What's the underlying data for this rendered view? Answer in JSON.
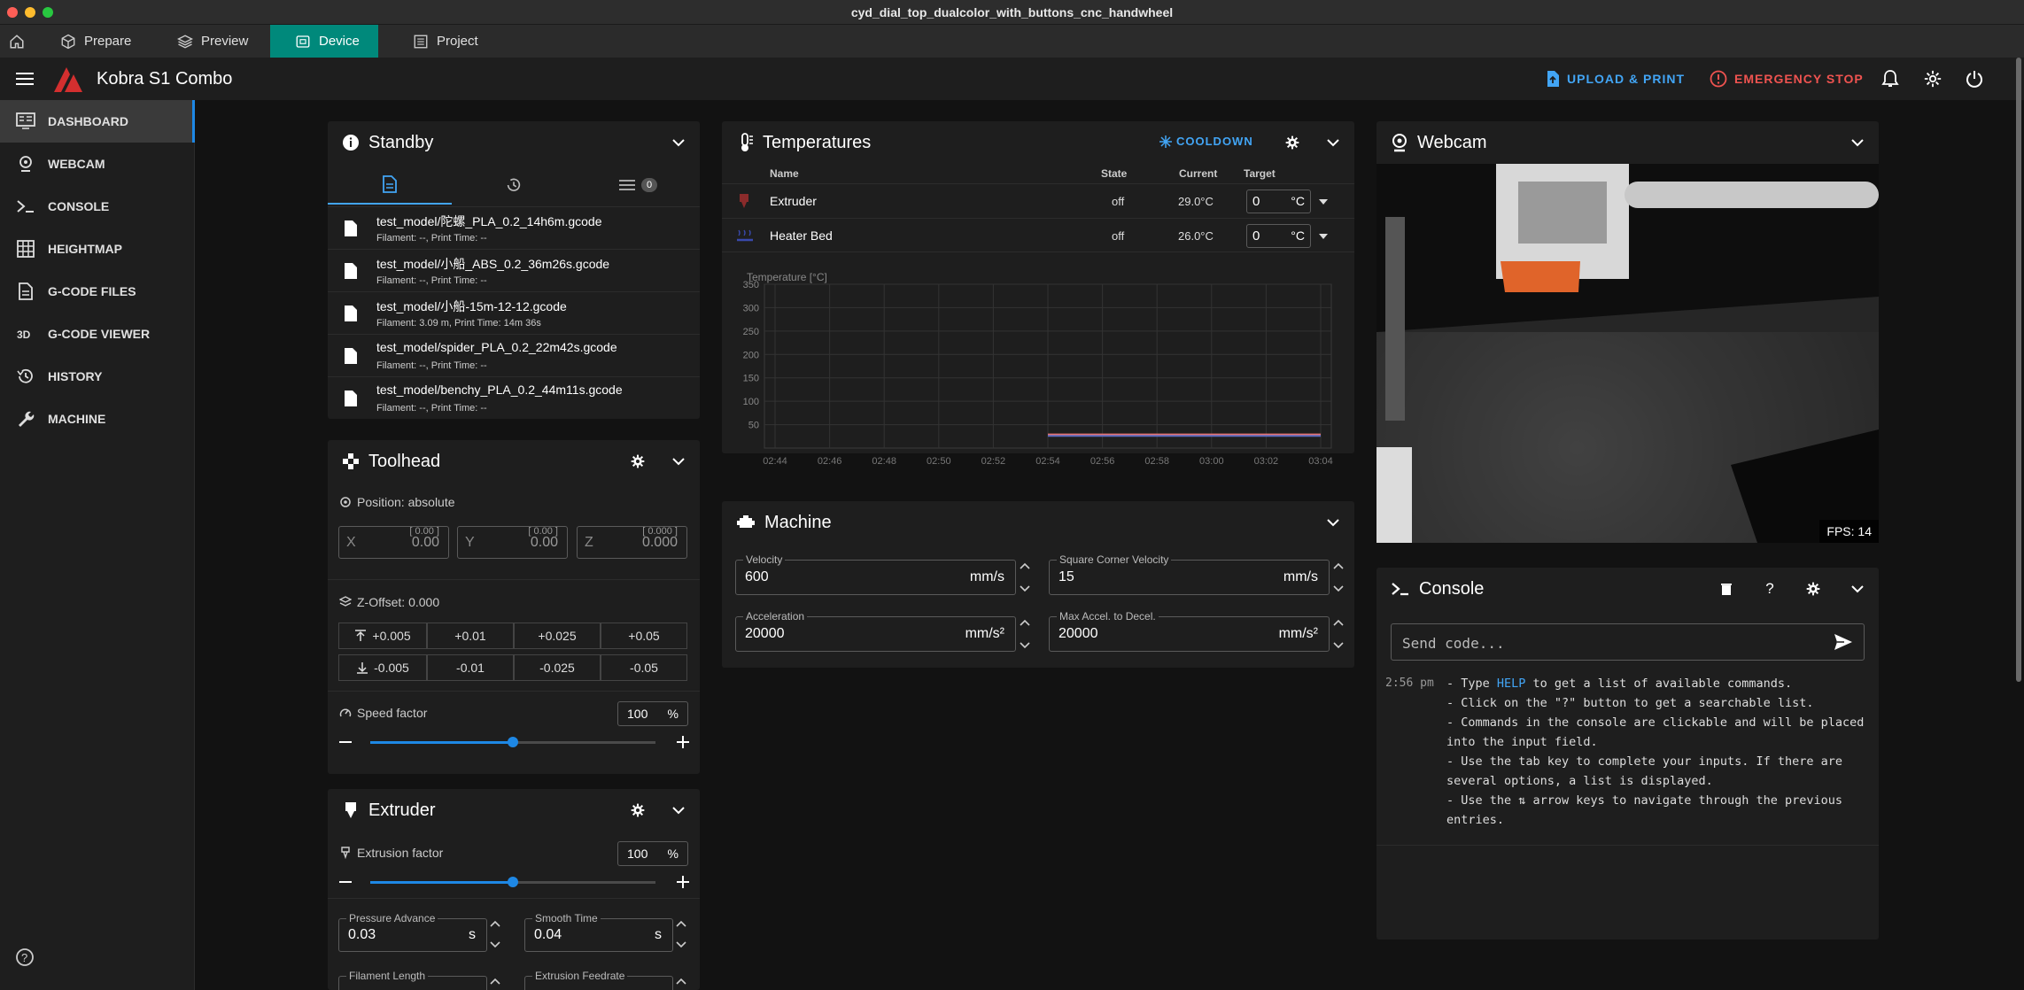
{
  "window": {
    "title": "cyd_dial_top_dualcolor_with_buttons_cnc_handwheel"
  },
  "tabs": [
    {
      "label": "Prepare"
    },
    {
      "label": "Preview"
    },
    {
      "label": "Device"
    },
    {
      "label": "Project"
    }
  ],
  "appbar": {
    "title": "Kobra S1 Combo",
    "upload_label": "UPLOAD & PRINT",
    "estop_label": "EMERGENCY STOP"
  },
  "sidebar": {
    "items": [
      {
        "label": "DASHBOARD",
        "icon": "dashboard-icon"
      },
      {
        "label": "WEBCAM",
        "icon": "webcam-icon"
      },
      {
        "label": "CONSOLE",
        "icon": "console-icon"
      },
      {
        "label": "HEIGHTMAP",
        "icon": "grid-icon"
      },
      {
        "label": "G-CODE FILES",
        "icon": "file-icon"
      },
      {
        "label": "G-CODE VIEWER",
        "icon": "3d-icon"
      },
      {
        "label": "HISTORY",
        "icon": "history-icon"
      },
      {
        "label": "MACHINE",
        "icon": "wrench-icon"
      }
    ]
  },
  "standby": {
    "title": "Standby",
    "queue_count": "0",
    "files": [
      {
        "name": "test_model/陀螺_PLA_0.2_14h6m.gcode",
        "meta": "Filament: --, Print Time: --"
      },
      {
        "name": "test_model/小船_ABS_0.2_36m26s.gcode",
        "meta": "Filament: --, Print Time: --"
      },
      {
        "name": "test_model/小船-15m-12-12.gcode",
        "meta": "Filament: 3.09 m, Print Time: 14m 36s"
      },
      {
        "name": "test_model/spider_PLA_0.2_22m42s.gcode",
        "meta": "Filament: --, Print Time: --"
      },
      {
        "name": "test_model/benchy_PLA_0.2_44m11s.gcode",
        "meta": "Filament: --, Print Time: --"
      }
    ]
  },
  "toolhead": {
    "title": "Toolhead",
    "position_label": "Position: absolute",
    "axes": [
      {
        "label": "X",
        "value": "0.00",
        "hint": "[ 0.00 ]"
      },
      {
        "label": "Y",
        "value": "0.00",
        "hint": "[ 0.00 ]"
      },
      {
        "label": "Z",
        "value": "0.000",
        "hint": "[ 0.000 ]"
      }
    ],
    "zoffset_label": "Z-Offset: 0.000",
    "zup": [
      "+0.005",
      "+0.01",
      "+0.025",
      "+0.05"
    ],
    "zdown": [
      "-0.005",
      "-0.01",
      "-0.025",
      "-0.05"
    ],
    "speed_label": "Speed factor",
    "speed_value": "100",
    "speed_unit": "%",
    "speed_fraction": 0.5
  },
  "extruder": {
    "title": "Extruder",
    "factor_label": "Extrusion factor",
    "factor_value": "100",
    "factor_unit": "%",
    "factor_fraction": 0.5,
    "pa_label": "Pressure Advance",
    "pa_value": "0.03",
    "pa_unit": "s",
    "st_label": "Smooth Time",
    "st_value": "0.04",
    "st_unit": "s",
    "fl_label": "Filament Length",
    "ef_label": "Extrusion Feedrate"
  },
  "temps": {
    "title": "Temperatures",
    "cooldown_label": "COOLDOWN",
    "headers": {
      "name": "Name",
      "state": "State",
      "current": "Current",
      "target": "Target"
    },
    "rows": [
      {
        "name": "Extruder",
        "state": "off",
        "current": "29.0°C",
        "target": "0",
        "unit": "°C"
      },
      {
        "name": "Heater Bed",
        "state": "off",
        "current": "26.0°C",
        "target": "0",
        "unit": "°C"
      }
    ]
  },
  "chart_data": {
    "type": "line",
    "ylabel": "Temperature [°C]",
    "ylim": [
      0,
      350
    ],
    "yticks": [
      "350",
      "300",
      "250",
      "200",
      "150",
      "100",
      "50"
    ],
    "categories": [
      "02:44",
      "02:46",
      "02:48",
      "02:50",
      "02:52",
      "02:54",
      "02:56",
      "02:58",
      "03:00",
      "03:02",
      "03:04"
    ],
    "series": [
      {
        "color": "#e57373",
        "values": [
          null,
          null,
          null,
          null,
          null,
          29,
          29,
          29,
          29,
          29,
          29
        ]
      },
      {
        "color": "#5c6bc0",
        "values": [
          null,
          null,
          null,
          null,
          null,
          26,
          26,
          26,
          26,
          26,
          26
        ]
      }
    ]
  },
  "machine": {
    "title": "Machine",
    "velocity_label": "Velocity",
    "velocity_value": "600",
    "velocity_unit": "mm/s",
    "scv_label": "Square Corner Velocity",
    "scv_value": "15",
    "scv_unit": "mm/s",
    "accel_label": "Acceleration",
    "accel_value": "20000",
    "accel_unit": "mm/s²",
    "decel_label": "Max Accel. to Decel.",
    "decel_value": "20000",
    "decel_unit": "mm/s²"
  },
  "webcam": {
    "title": "Webcam",
    "fps": "FPS: 14"
  },
  "console": {
    "title": "Console",
    "placeholder": "Send code...",
    "time": "2:56 pm",
    "lines": [
      {
        "pre": "- Type ",
        "link": "HELP",
        "post": " to get a list of available commands."
      },
      {
        "pre": "- Click on the \"?\" button to get a searchable list.",
        "link": "",
        "post": ""
      },
      {
        "pre": "- Commands in the console are clickable and will be placed",
        "link": "",
        "post": ""
      },
      {
        "pre": "into the input field.",
        "link": "",
        "post": ""
      },
      {
        "pre": "- Use the tab key to complete your inputs. If there are",
        "link": "",
        "post": ""
      },
      {
        "pre": "several options, a list is displayed.",
        "link": "",
        "post": ""
      },
      {
        "pre": "- Use the ⇅ arrow keys to navigate through the previous",
        "link": "",
        "post": ""
      },
      {
        "pre": "entries.",
        "link": "",
        "post": ""
      }
    ]
  }
}
